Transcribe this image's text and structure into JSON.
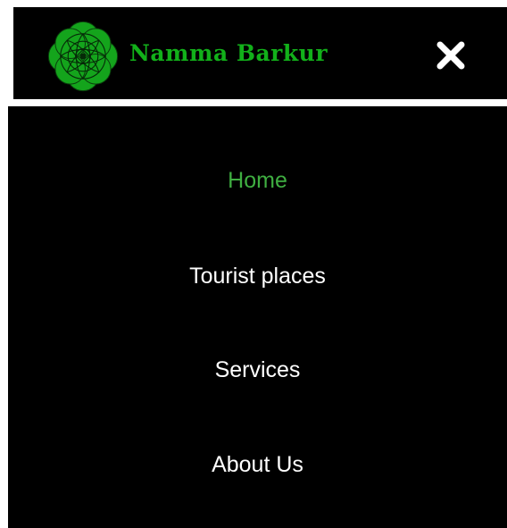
{
  "header": {
    "brand_name": "Namma Barkur",
    "logo_icon": "flower-mandala-logo",
    "close_icon": "close-x-icon"
  },
  "colors": {
    "brand_green": "#12b01a",
    "active_link": "#3fae41",
    "background": "#000000",
    "text": "#ffffff"
  },
  "menu": {
    "items": [
      {
        "label": "Home",
        "active": true
      },
      {
        "label": "Tourist places",
        "active": false
      },
      {
        "label": "Services",
        "active": false
      },
      {
        "label": "About Us",
        "active": false
      }
    ]
  }
}
